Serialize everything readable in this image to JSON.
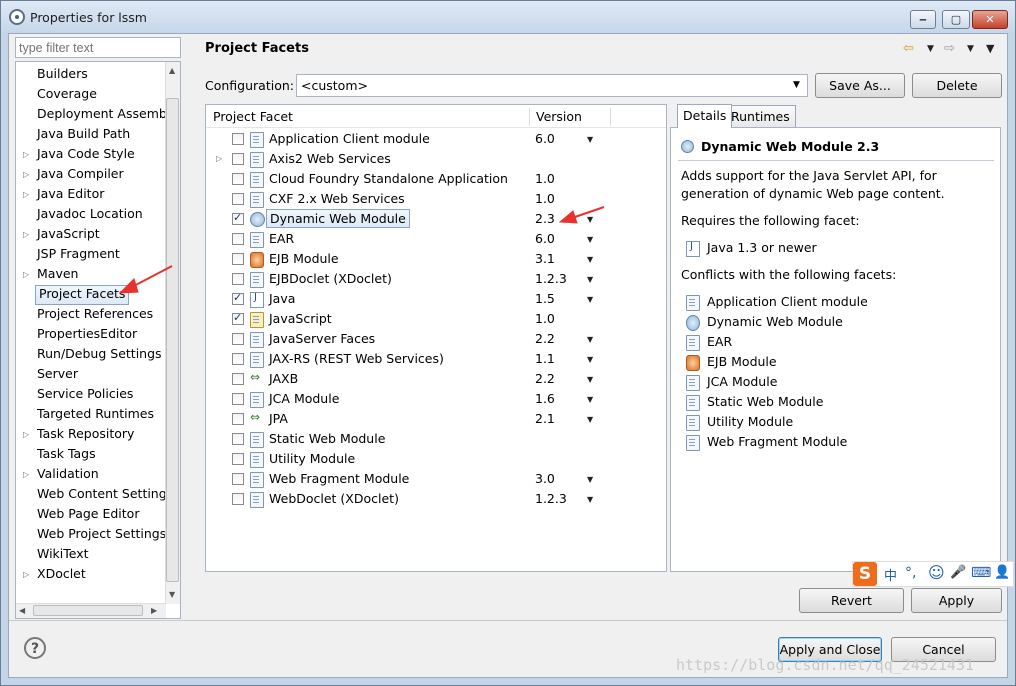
{
  "window": {
    "title": "Properties for lssm",
    "minimize": "‒",
    "maximize": "▢",
    "close": "✕"
  },
  "nav": {
    "filter_placeholder": "type filter text",
    "items": [
      {
        "label": "Builders",
        "expandable": false
      },
      {
        "label": "Coverage",
        "expandable": false
      },
      {
        "label": "Deployment Assembly",
        "expandable": false
      },
      {
        "label": "Java Build Path",
        "expandable": false
      },
      {
        "label": "Java Code Style",
        "expandable": true
      },
      {
        "label": "Java Compiler",
        "expandable": true
      },
      {
        "label": "Java Editor",
        "expandable": true
      },
      {
        "label": "Javadoc Location",
        "expandable": false
      },
      {
        "label": "JavaScript",
        "expandable": true
      },
      {
        "label": "JSP Fragment",
        "expandable": false
      },
      {
        "label": "Maven",
        "expandable": true
      },
      {
        "label": "Project Facets",
        "expandable": false,
        "selected": true
      },
      {
        "label": "Project References",
        "expandable": false
      },
      {
        "label": "PropertiesEditor",
        "expandable": false
      },
      {
        "label": "Run/Debug Settings",
        "expandable": false
      },
      {
        "label": "Server",
        "expandable": false
      },
      {
        "label": "Service Policies",
        "expandable": false
      },
      {
        "label": "Targeted Runtimes",
        "expandable": false
      },
      {
        "label": "Task Repository",
        "expandable": true
      },
      {
        "label": "Task Tags",
        "expandable": false
      },
      {
        "label": "Validation",
        "expandable": true
      },
      {
        "label": "Web Content Settings",
        "expandable": false
      },
      {
        "label": "Web Page Editor",
        "expandable": false
      },
      {
        "label": "Web Project Settings",
        "expandable": false
      },
      {
        "label": "WikiText",
        "expandable": false
      },
      {
        "label": "XDoclet",
        "expandable": true
      }
    ]
  },
  "page": {
    "title": "Project Facets",
    "config_label": "Configuration:",
    "config_value": "<custom>",
    "save_as": "Save As...",
    "delete": "Delete"
  },
  "facets": {
    "col_facet": "Project Facet",
    "col_version": "Version",
    "rows": [
      {
        "name": "Application Client module",
        "version": "6.0",
        "checked": false,
        "icon": "document-icon",
        "dropdown": true
      },
      {
        "name": "Axis2 Web Services",
        "version": "",
        "checked": false,
        "icon": "document-icon",
        "dropdown": false,
        "expandable": true
      },
      {
        "name": "Cloud Foundry Standalone Application",
        "version": "1.0",
        "checked": false,
        "icon": "document-icon",
        "dropdown": false
      },
      {
        "name": "CXF 2.x Web Services",
        "version": "1.0",
        "checked": false,
        "icon": "document-icon",
        "dropdown": false
      },
      {
        "name": "Dynamic Web Module",
        "version": "2.3",
        "checked": true,
        "icon": "globe-icon",
        "dropdown": true,
        "highlight": true
      },
      {
        "name": "EAR",
        "version": "6.0",
        "checked": false,
        "icon": "document-icon",
        "dropdown": true
      },
      {
        "name": "EJB Module",
        "version": "3.1",
        "checked": false,
        "icon": "ejb-icon",
        "dropdown": true
      },
      {
        "name": "EJBDoclet (XDoclet)",
        "version": "1.2.3",
        "checked": false,
        "icon": "document-icon",
        "dropdown": true
      },
      {
        "name": "Java",
        "version": "1.5",
        "checked": true,
        "icon": "java-file-icon",
        "dropdown": true
      },
      {
        "name": "JavaScript",
        "version": "1.0",
        "checked": true,
        "icon": "javascript-icon",
        "dropdown": false
      },
      {
        "name": "JavaServer Faces",
        "version": "2.2",
        "checked": false,
        "icon": "document-icon",
        "dropdown": true
      },
      {
        "name": "JAX-RS (REST Web Services)",
        "version": "1.1",
        "checked": false,
        "icon": "document-icon",
        "dropdown": true
      },
      {
        "name": "JAXB",
        "version": "2.2",
        "checked": false,
        "icon": "diamond-icon",
        "dropdown": true
      },
      {
        "name": "JCA Module",
        "version": "1.6",
        "checked": false,
        "icon": "document-icon",
        "dropdown": true
      },
      {
        "name": "JPA",
        "version": "2.1",
        "checked": false,
        "icon": "diamond-icon",
        "dropdown": true
      },
      {
        "name": "Static Web Module",
        "version": "",
        "checked": false,
        "icon": "document-icon",
        "dropdown": false
      },
      {
        "name": "Utility Module",
        "version": "",
        "checked": false,
        "icon": "document-icon",
        "dropdown": false
      },
      {
        "name": "Web Fragment Module",
        "version": "3.0",
        "checked": false,
        "icon": "document-icon",
        "dropdown": true
      },
      {
        "name": "WebDoclet (XDoclet)",
        "version": "1.2.3",
        "checked": false,
        "icon": "document-icon",
        "dropdown": true
      }
    ]
  },
  "details": {
    "tab_details": "Details",
    "tab_runtimes": "Runtimes",
    "title": "Dynamic Web Module 2.3",
    "desc_line1": "Adds support for the Java Servlet API, for",
    "desc_line2": "generation of dynamic Web page content.",
    "requires_label": "Requires the following facet:",
    "requires": [
      {
        "label": "Java 1.3 or newer",
        "icon": "java-file-icon"
      }
    ],
    "conflicts_label": "Conflicts with the following facets:",
    "conflicts": [
      {
        "label": "Application Client module",
        "icon": "document-icon"
      },
      {
        "label": "Dynamic Web Module",
        "icon": "globe-icon"
      },
      {
        "label": "EAR",
        "icon": "document-icon"
      },
      {
        "label": "EJB Module",
        "icon": "ejb-icon"
      },
      {
        "label": "JCA Module",
        "icon": "document-icon"
      },
      {
        "label": "Static Web Module",
        "icon": "document-icon"
      },
      {
        "label": "Utility Module",
        "icon": "document-icon"
      },
      {
        "label": "Web Fragment Module",
        "icon": "document-icon"
      }
    ]
  },
  "buttons": {
    "revert": "Revert",
    "apply": "Apply",
    "apply_close": "Apply and Close",
    "cancel": "Cancel",
    "help": "?"
  },
  "ime": {
    "logo": "S",
    "lang": "中",
    "punct": "°,",
    "emoji": "☺",
    "mic": "🎤",
    "keyboard": "⌨",
    "user": "👤"
  },
  "watermark": "https://blog.csdn.net/qq_24521431",
  "colors": {
    "annotation_arrow": "#e8322c"
  }
}
